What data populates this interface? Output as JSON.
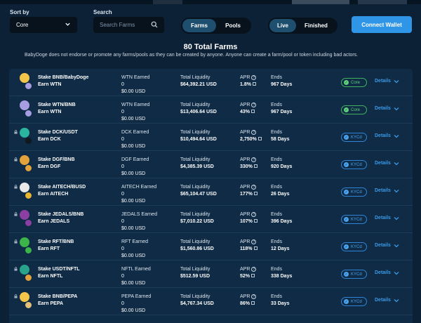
{
  "filters": {
    "sort_label": "Sort by",
    "sort_value": "Core",
    "search_label": "Search",
    "search_placeholder": "Search Farms",
    "type_toggle": {
      "options": [
        "Farms",
        "Pools"
      ],
      "active": "Farms"
    },
    "status_toggle": {
      "options": [
        "Live",
        "Finished"
      ],
      "active": "Live"
    },
    "connect_label": "Connect Wallet"
  },
  "summary": {
    "total": "80 Total Farms",
    "disclaimer": "BabyDoge does not endorse or promote any farms/pools as they can be created by anyone. Anyone can create a farm/pool or token including bad actors."
  },
  "colors": {
    "background": "#0c2136",
    "table": "#0f2b45",
    "accent": "#2f95e6",
    "core_badge": "#5fd27a",
    "kyc_badge": "#4aa3f0"
  },
  "farms": [
    {
      "stake": "Stake BNB/BabyDoge",
      "earn": "Earn WTN",
      "earned_label": "WTN Earned",
      "earned_value": "0",
      "earned_usd": "$0.00 USD",
      "liquidity_label": "Total Liquidity",
      "liquidity": "$64,392.21 USD",
      "apr_label": "APR",
      "apr": "1.8%",
      "ends_label": "Ends",
      "ends": "967 Days",
      "badge": "Core",
      "badge_type": "core",
      "locked": false,
      "details": "Details",
      "token1_color": "#f3c64b",
      "token2_color": "#a69ee0"
    },
    {
      "stake": "Stake WTN/BNB",
      "earn": "Earn WTN",
      "earned_label": "WTN Earned",
      "earned_value": "0",
      "earned_usd": "$0.00 USD",
      "liquidity_label": "Total Liquidity",
      "liquidity": "$13,406.64 USD",
      "apr_label": "APR",
      "apr": "43%",
      "ends_label": "Ends",
      "ends": "967 Days",
      "badge": "Core",
      "badge_type": "core",
      "locked": false,
      "details": "Details",
      "token1_color": "#a69ee0",
      "token2_color": "#a69ee0"
    },
    {
      "stake": "Stake DCK/USDT",
      "earn": "Earn DCK",
      "earned_label": "DCK Earned",
      "earned_value": "0",
      "earned_usd": "$0.00 USD",
      "liquidity_label": "Total Liquidity",
      "liquidity": "$10,494.64 USD",
      "apr_label": "APR",
      "apr": "2,750%",
      "ends_label": "Ends",
      "ends": "58 Days",
      "badge": "KYCd",
      "badge_type": "kyc",
      "locked": true,
      "details": "Details",
      "token1_color": "#2bb5a0",
      "token2_color": "#111820"
    },
    {
      "stake": "Stake DGF/BNB",
      "earn": "Earn DGF",
      "earned_label": "DGF Earned",
      "earned_value": "0",
      "earned_usd": "$0.00 USD",
      "liquidity_label": "Total Liquidity",
      "liquidity": "$4,385.39 USD",
      "apr_label": "APR",
      "apr": "330%",
      "ends_label": "Ends",
      "ends": "920 Days",
      "badge": "KYCd",
      "badge_type": "kyc",
      "locked": true,
      "details": "Details",
      "token1_color": "#e3a23a",
      "token2_color": "#e3a23a"
    },
    {
      "stake": "Stake AITECH/BUSD",
      "earn": "Earn AITECH",
      "earned_label": "AITECH Earned",
      "earned_value": "0",
      "earned_usd": "$0.00 USD",
      "liquidity_label": "Total Liquidity",
      "liquidity": "$65,104.47 USD",
      "apr_label": "APR",
      "apr": "177%",
      "ends_label": "Ends",
      "ends": "26 Days",
      "badge": "KYCd",
      "badge_type": "kyc",
      "locked": true,
      "details": "Details",
      "token1_color": "#e8e8e8",
      "token2_color": "#e9b430"
    },
    {
      "stake": "Stake JEDALS/BNB",
      "earn": "Earn JEDALS",
      "earned_label": "JEDALS Earned",
      "earned_value": "0",
      "earned_usd": "$0.00 USD",
      "liquidity_label": "Total Liquidity",
      "liquidity": "$7,010.22 USD",
      "apr_label": "APR",
      "apr": "107%",
      "ends_label": "Ends",
      "ends": "396 Days",
      "badge": "KYCd",
      "badge_type": "kyc",
      "locked": true,
      "details": "Details",
      "token1_color": "#8c3fa3",
      "token2_color": "#8c3fa3"
    },
    {
      "stake": "Stake RFT/BNB",
      "earn": "Earn RFT",
      "earned_label": "RFT Earned",
      "earned_value": "0",
      "earned_usd": "$0.00 USD",
      "liquidity_label": "Total Liquidity",
      "liquidity": "$1,560.86 USD",
      "apr_label": "APR",
      "apr": "118%",
      "ends_label": "Ends",
      "ends": "12 Days",
      "badge": "KYCd",
      "badge_type": "kyc",
      "locked": true,
      "details": "Details",
      "token1_color": "#3bb54a",
      "token2_color": "#3bb54a"
    },
    {
      "stake": "Stake USDT/NFTL",
      "earn": "Earn NFTL",
      "earned_label": "NFTL Earned",
      "earned_value": "0",
      "earned_usd": "$0.00 USD",
      "liquidity_label": "Total Liquidity",
      "liquidity": "$512.59 USD",
      "apr_label": "APR",
      "apr": "52%",
      "ends_label": "Ends",
      "ends": "338 Days",
      "badge": "KYCd",
      "badge_type": "kyc",
      "locked": true,
      "details": "Details",
      "token1_color": "#2aa38c",
      "token2_color": "#e2a13a"
    },
    {
      "stake": "Stake BNB/PEPA",
      "earn": "Earn PEPA",
      "earned_label": "PEPA Earned",
      "earned_value": "0",
      "earned_usd": "$0.00 USD",
      "liquidity_label": "Total Liquidity",
      "liquidity": "$4,767.34 USD",
      "apr_label": "APR",
      "apr": "86%",
      "ends_label": "Ends",
      "ends": "33 Days",
      "badge": "KYCd",
      "badge_type": "kyc",
      "locked": true,
      "details": "Details",
      "token1_color": "#f3c64b",
      "token2_color": "#e2c07a"
    }
  ]
}
